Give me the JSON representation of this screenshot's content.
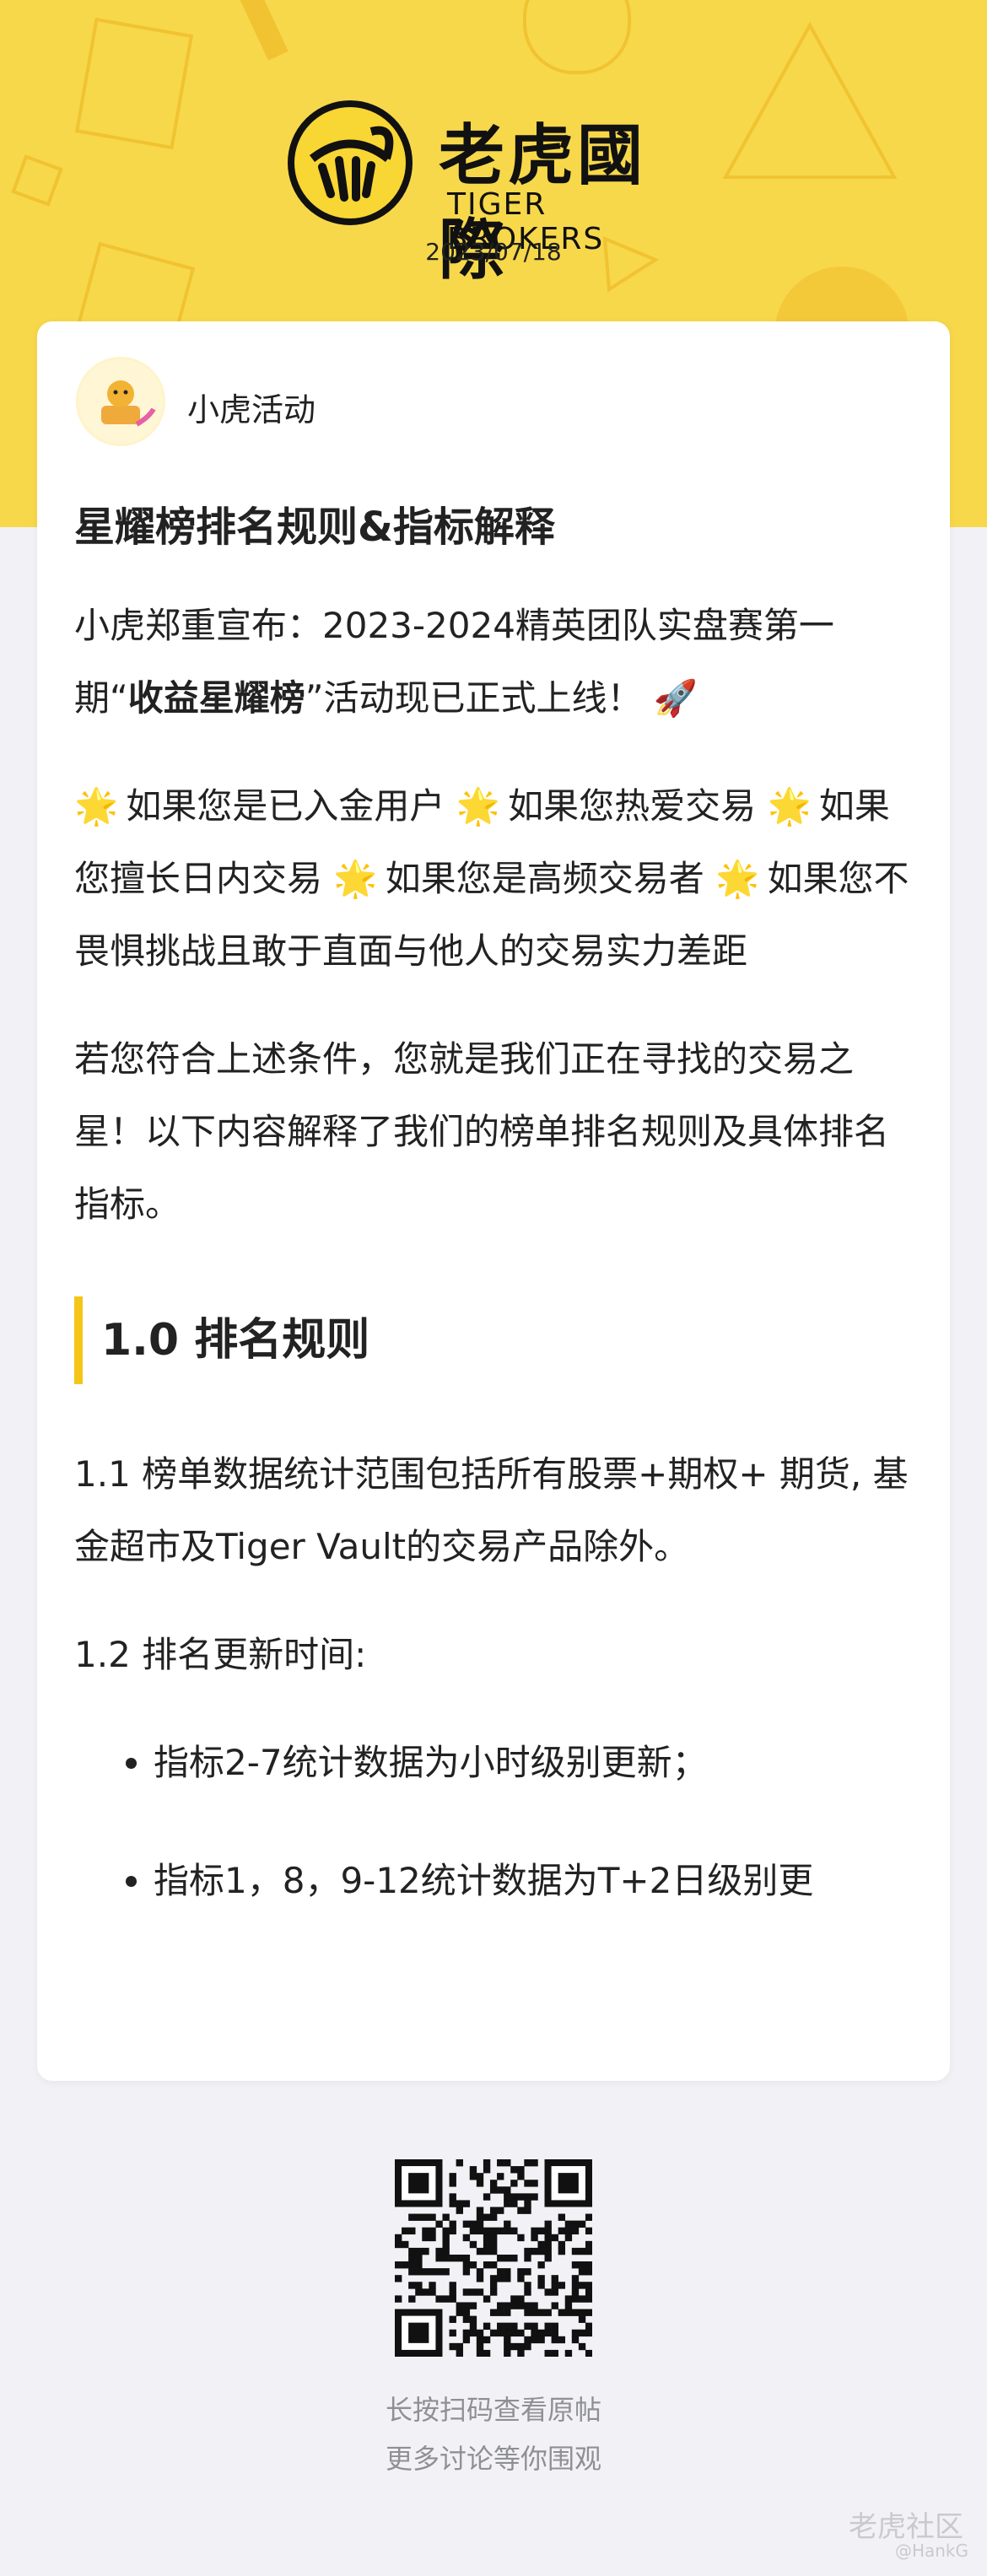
{
  "brand": {
    "name_cn": "老虎國際",
    "name_en": "TIGER BROKERS",
    "date": "2023/07/18"
  },
  "author": {
    "name": "小虎活动",
    "avatar": "tiger-avatar-icon"
  },
  "article": {
    "title": "星耀榜排名规则&指标解释",
    "intro_prefix": "小虎郑重宣布：2023-2024精英团队实盘赛第一期“",
    "intro_bold": "收益星耀榜",
    "intro_suffix": "”活动现已正式上线！",
    "intro_emoji": "🚀",
    "conditions": [
      "如果您是已入金用户",
      "如果您热爱交易",
      "如果您擅长日内交易",
      "如果您是高频交易者",
      "如果您不畏惧挑战且敢于直面与他人的交易实力差距"
    ],
    "star_emoji": "🌟",
    "summary": "若您符合上述条件，您就是我们正在寻找的交易之星！以下内容解释了我们的榜单排名规则及具体排名指标。",
    "section_title": "1.0 排名规则",
    "rule_1_1": "1.1 榜单数据统计范围包括所有股票+期权+ 期货, 基金超市及Tiger Vault的交易产品除外。",
    "rule_1_2": "1.2 排名更新时间:",
    "bullets": [
      "指标2-7统计数据为小时级别更新；",
      "指标1，8，9-12统计数据为T+2日级别更"
    ]
  },
  "footer": {
    "qr_icon": "qr-code-icon",
    "caption_1": "长按扫码查看原帖",
    "caption_2": "更多讨论等你围观",
    "watermark_1": "老虎社区",
    "watermark_2": "@HankG"
  },
  "colors": {
    "hero_yellow": "#f7d84a",
    "accent_bar": "#f5c518",
    "page_bg": "#f2f2f6"
  }
}
